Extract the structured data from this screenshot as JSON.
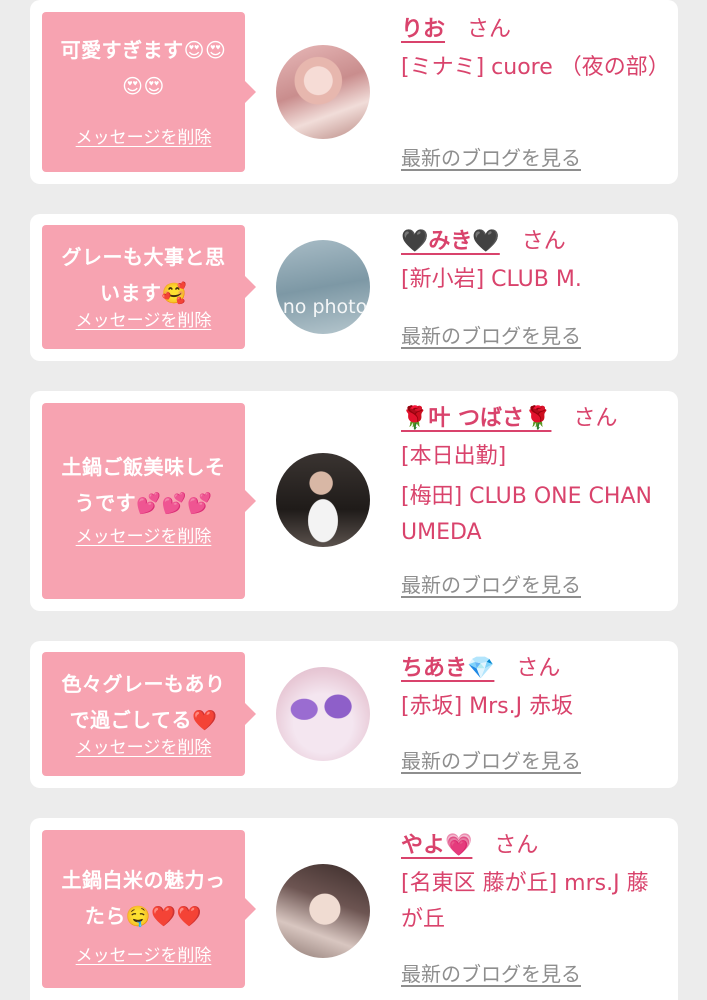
{
  "colors": {
    "page_bg": "#ececec",
    "card_bg": "#ffffff",
    "bubble_bg": "#f7a3b1",
    "accent": "#d9436c",
    "link_gray": "#8e8e8e"
  },
  "cards": [
    {
      "message": "可愛すぎます😍😍😍😍",
      "delete_label": "メッセージを削除",
      "name": "りお",
      "suffix": "さん",
      "shop": "[ミナミ] cuore （夜の部）",
      "blog_label": "最新のブログを見る"
    },
    {
      "message": "グレーも大事と思います🥰",
      "delete_label": "メッセージを削除",
      "name": "🖤みき🖤",
      "suffix": "さん",
      "shop": "[新小岩] CLUB M.",
      "avatar_text": "no photo",
      "blog_label": "最新のブログを見る"
    },
    {
      "message": "土鍋ご飯美味しそうです💕💕💕",
      "delete_label": "メッセージを削除",
      "name": "🌹叶 つばさ🌹",
      "suffix": "さん",
      "status": "[本日出勤]",
      "shop": "[梅田] CLUB ONE CHAN UMEDA",
      "blog_label": "最新のブログを見る"
    },
    {
      "message": "色々グレーもありで過ごしてる❤️",
      "delete_label": "メッセージを削除",
      "name": "ちあき💎",
      "suffix": "さん",
      "shop": "[赤坂] Mrs.J 赤坂",
      "blog_label": "最新のブログを見る"
    },
    {
      "message": "土鍋白米の魅力ったら🤤❤️❤️",
      "delete_label": "メッセージを削除",
      "name": "やよ💗",
      "suffix": "さん",
      "shop": "[名東区 藤が丘] mrs.J 藤が丘",
      "blog_label": "最新のブログを見る"
    }
  ]
}
